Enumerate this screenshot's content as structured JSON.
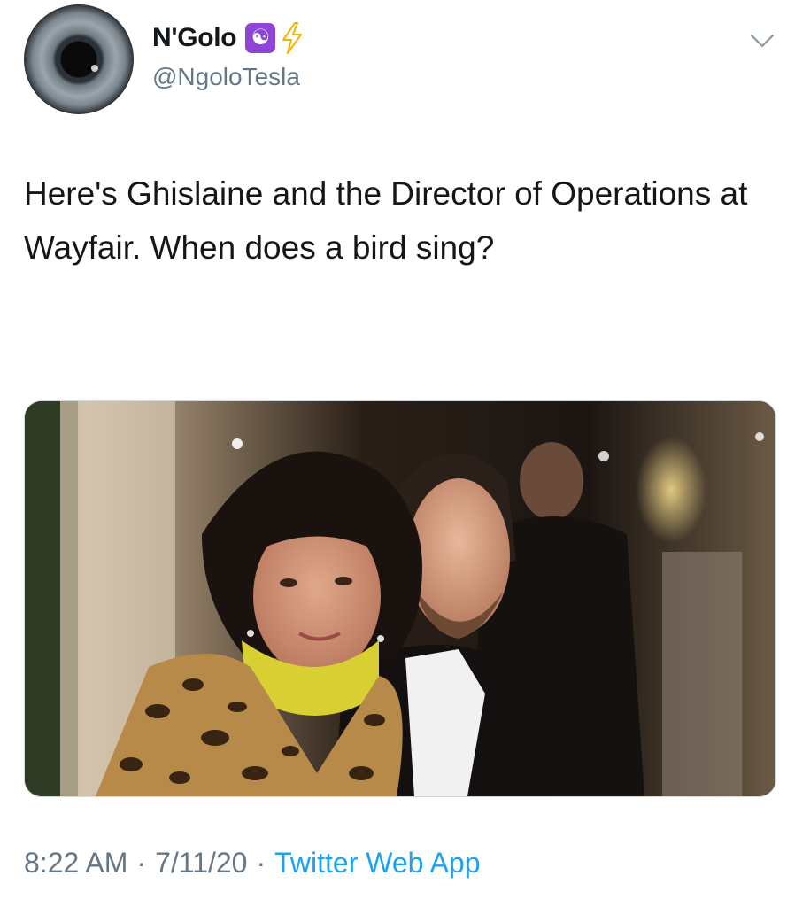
{
  "author": {
    "display_name": "N'Golo",
    "handle": "@NgoloTesla",
    "badge_emoji": "☯",
    "bolt_icon": "lightning-bolt-icon",
    "badge_color": "#8e44d6",
    "bolt_color": "#f0b400"
  },
  "tweet": {
    "text": "Here's Ghislaine and the Director of Operations at Wayfair. When does a bird sing?"
  },
  "meta": {
    "time": "8:22 AM",
    "date": "7/11/20",
    "separator": "·",
    "source": "Twitter Web App"
  },
  "colors": {
    "link": "#1da1f2",
    "secondary_text": "#657786",
    "primary_text": "#14171a"
  }
}
